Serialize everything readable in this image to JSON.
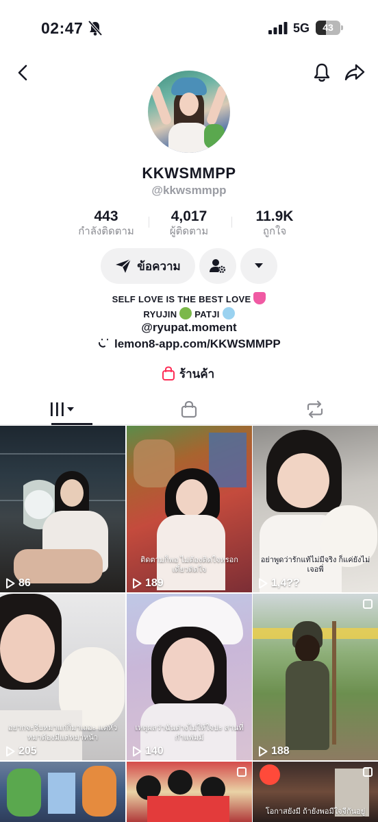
{
  "status_bar": {
    "time": "02:47",
    "network": "5G",
    "battery": "43",
    "battery_level": 0.43
  },
  "profile": {
    "display_name": "KKWSMMPP",
    "username": "@kkwsmmpp",
    "stats": [
      {
        "value": "443",
        "label": "กำลังติดตาม"
      },
      {
        "value": "4,017",
        "label": "ผู้ติดตาม"
      },
      {
        "value": "11.9K",
        "label": "ถูกใจ"
      }
    ],
    "message_label": "ข้อความ",
    "bio": {
      "line1": "SELF LOVE IS THE BEST LOVE",
      "line2a": "RYUJIN",
      "line2b": "PATJI",
      "line3": "@ryupat.moment"
    },
    "link": "lemon8-app.com/KKWSMMPP",
    "shop_label": "ร้านค้า"
  },
  "tabs": [
    {
      "name": "videos",
      "icon": "grid-icon"
    },
    {
      "name": "shop",
      "icon": "shopping-bag-icon"
    },
    {
      "name": "reposts",
      "icon": "repost-icon"
    }
  ],
  "videos": [
    {
      "views": "86",
      "caption": ""
    },
    {
      "views": "189",
      "caption": "ติดตามก็พอ ไม่ต้องติดใจหรอกเดี๋ยวติดใจ"
    },
    {
      "views": "1,4??",
      "caption": "อย่าพูดว่ารักแท้ไม่มีจริง ก็แค่ยังไม่เจอพี่"
    },
    {
      "views": "205",
      "caption": "อยากจะรีบหมาแก่ก็มาเถอะ แต่หัวหมาต้องมีแต่หมาหน้า"
    },
    {
      "views": "140",
      "caption": "เหตุผลว่าฉันต่างไม่ให้ใจปะ สานที่กำแพ่มม์"
    },
    {
      "views": "188",
      "caption": ""
    },
    {
      "views": "",
      "caption": ""
    },
    {
      "views": "",
      "caption": ""
    },
    {
      "views": "",
      "caption": "โอกาสยังมี ถ้ายังพอมีใจจีกันอยู่"
    }
  ]
}
